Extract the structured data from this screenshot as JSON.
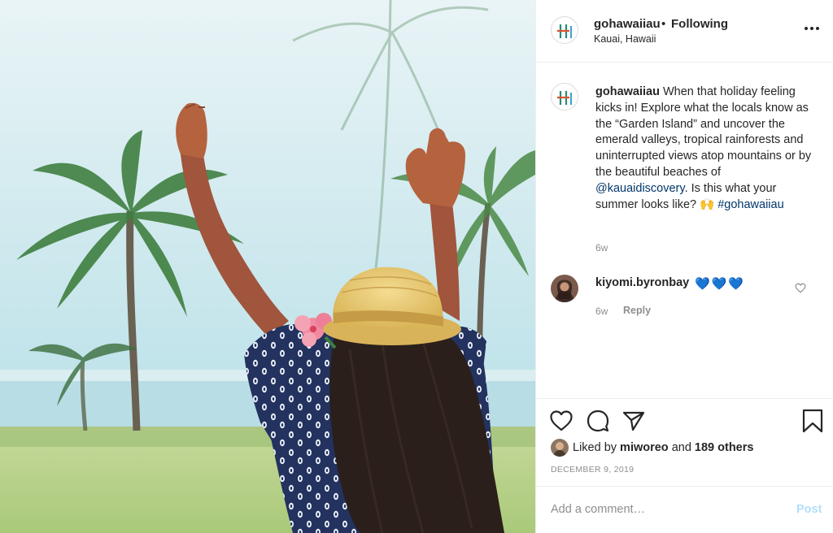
{
  "post": {
    "username": "gohawaiiau",
    "separator": "•",
    "follow_status": "Following",
    "location": "Kauai, Hawaii",
    "more_icon": "more-options-icon"
  },
  "caption": {
    "username": "gohawaiiau",
    "text_1": " When that holiday feeling kicks in! Explore what the locals know as the “Garden Island” and uncover the emerald valleys, tropical rainforests and uninterrupted views atop mountains or by the beautiful beaches of ",
    "mention": "@kauaidiscovery",
    "text_2": ". Is this what your summer looks like? 🙌 ",
    "hashtag": "#gohawaiiau",
    "time": "6w"
  },
  "comments": [
    {
      "username": "kiyomi.byronbay",
      "text": "💙💙💙",
      "time": "6w",
      "reply_label": "Reply"
    }
  ],
  "actions": {
    "like_icon": "heart-icon",
    "comment_icon": "comment-icon",
    "share_icon": "share-icon",
    "save_icon": "bookmark-icon"
  },
  "likes": {
    "prefix": "Liked by ",
    "user": "miworeo",
    "middle": " and ",
    "others": "189 others"
  },
  "date": "DECEMBER 9, 2019",
  "comment_box": {
    "placeholder": "Add a comment…",
    "post_label": "Post"
  },
  "colors": {
    "link": "#00376b",
    "post_button": "#b2dffc",
    "muted": "#8e8e8e"
  }
}
